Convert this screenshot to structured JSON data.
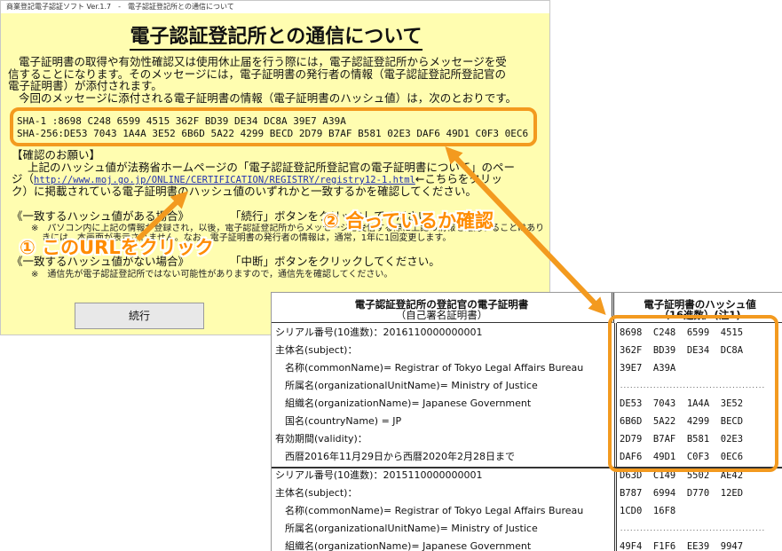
{
  "window": {
    "title": "商業登記電子認証ソフト Ver.1.7　-　電子認証登記所との通信について"
  },
  "dialog": {
    "heading": "電子認証登記所との通信について",
    "para1_line1": "電子証明書の取得や有効性確認又は使用休止届を行う際には，電子認証登記所からメッセージを受",
    "para1_line2": "信することになります。そのメッセージには，電子証明書の発行者の情報（電子認証登記所登記官の",
    "para1_line3": "電子証明書）が添付されます。",
    "para2": "今回のメッセージに添付される電子証明書の情報（電子証明書のハッシュ値）は，次のとおりです。",
    "sha1": "SHA-1  :8698 C248 6599 4515 362F BD39 DE34 DC8A 39E7 A39A",
    "sha256": "SHA-256:DE53 7043 1A4A 3E52 6B6D 5A22 4299 BECD 2D79 B7AF B581 02E3 DAF6 49D1 C0F3 0EC6",
    "confirm_title": "【確認のお願い】",
    "confirm_line1": "上記のハッシュ値が法務省ホームページの「電子認証登記所登記官の電子証明書について」のペー",
    "confirm_line2_pre": "ジ（",
    "confirm_link": "http://www.moj.go.jp/ONLINE/CERTIFICATION/REGISTRY/registry12-1.html",
    "confirm_line2_post": "←こちらをクリッ",
    "confirm_line3": "ク）に掲載されている電子証明書のハッシュ値のいずれかと一致するかを確認してください。",
    "match_label": "《一致するハッシュ値がある場合》",
    "match_action": "「続行」ボタンをクリックしてください。",
    "match_note1": "※　パソコン内に上記の情報が登録され，以後，電子認証登記所からメッセージを受信する際に上記の情報を確認することはありません。",
    "match_note2": "きには，本画面が表示されません。なお，電子証明書の発行者の情報は，通常，1年に1回変更します。",
    "nomatch_label": "《一致するハッシュ値がない場合》",
    "nomatch_action": "「中断」ボタンをクリックしてください。",
    "nomatch_note": "※　通信先が電子認証登記所ではない可能性がありますので，通信先を確認してください。",
    "continue_button": "続行"
  },
  "annotations": {
    "callout1": "① このURLをクリック",
    "callout2": "② 合っているか確認",
    "accent_color": "#f39a1f"
  },
  "cert_table": {
    "header_left_line1": "電子認証登記所の登記官の電子証明書",
    "header_left_line2": "（自己署名証明書）",
    "header_right_line1": "電子証明書のハッシュ値",
    "header_right_line2": "（16進数）(注1)",
    "rows": [
      {
        "label": "シリアル番号(10進数)：2016110000000001",
        "hash": "8698  C248  6599  4515"
      },
      {
        "label": "主体名(subject)：",
        "hash": "362F  BD39  DE34  DC8A"
      },
      {
        "label": "名称(commonName)= Registrar of Tokyo Legal Affairs Bureau",
        "hash": "39E7  A39A"
      },
      {
        "label": "所属名(organizationalUnitName)= Ministry of Justice",
        "hash": "............................................"
      },
      {
        "label": "組織名(organizationName)= Japanese Government",
        "hash": "DE53  7043  1A4A  3E52"
      },
      {
        "label": "国名(countryName) = JP",
        "hash": "6B6D  5A22  4299  BECD"
      },
      {
        "label": "有効期間(validity)：",
        "hash": "2D79  B7AF  B581  02E3"
      },
      {
        "label": "西暦2016年11月29日から西暦2020年2月28日まで",
        "hash": "DAF6  49D1  C0F3  0EC6"
      },
      {
        "label": "シリアル番号(10進数)：2015110000000001",
        "hash": "D63D  C149  5502  AE42"
      },
      {
        "label": "主体名(subject)：",
        "hash": "B787  6994  D770  12ED"
      },
      {
        "label": "名称(commonName)= Registrar of Tokyo Legal Affairs Bureau",
        "hash": "1CD0  16F8"
      },
      {
        "label": "所属名(organizationalUnitName)= Ministry of Justice",
        "hash": "............................................"
      },
      {
        "label": "組織名(organizationName)= Japanese Government",
        "hash": "49F4  F1F6  EE39  9947"
      }
    ]
  }
}
